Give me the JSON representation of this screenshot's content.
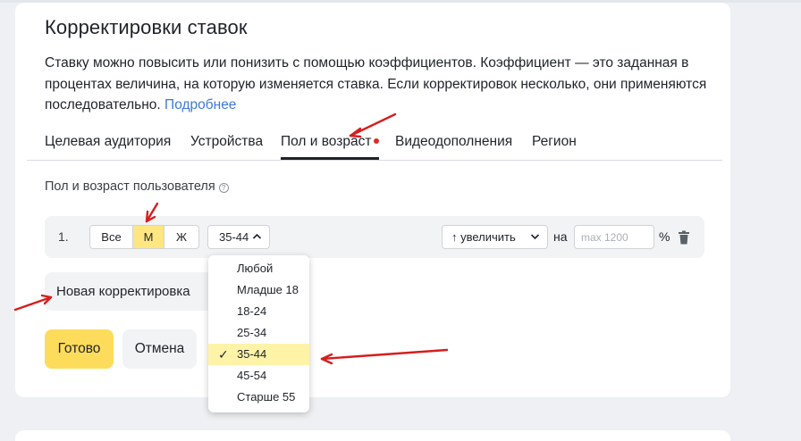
{
  "page": {
    "title": "Корректировки ставок",
    "description": "Ставку можно повысить или понизить с помощью коэффициентов. Коэффициент — это заданная в процентах величина, на которую изменяется ставка. Если корректировок несколько, они применяются последовательно.",
    "more_link": "Подробнее"
  },
  "tabs": [
    {
      "label": "Целевая аудитория",
      "active": false
    },
    {
      "label": "Устройства",
      "active": false
    },
    {
      "label": "Пол и возраст",
      "active": true
    },
    {
      "label": "Видеодополнения",
      "active": false
    },
    {
      "label": "Регион",
      "active": false
    }
  ],
  "section": {
    "label": "Пол и возраст пользователя",
    "help_icon": "question-circle-icon"
  },
  "row": {
    "number": "1.",
    "gender_options": [
      "Все",
      "М",
      "Ж"
    ],
    "gender_selected": "М",
    "age_value": "35-44",
    "direction_value": "↑ увеличить",
    "na_label": "на",
    "max_placeholder": "max 1200",
    "percent": "%",
    "delete_icon": "trash-icon"
  },
  "new_correction_label": "Новая корректировка",
  "buttons": {
    "done": "Готово",
    "cancel": "Отмена"
  },
  "age_dropdown": {
    "options": [
      "Любой",
      "Младше 18",
      "18-24",
      "25-34",
      "35-44",
      "45-54",
      "Старше 55"
    ],
    "selected": "35-44",
    "check_mark": "✓"
  },
  "colors": {
    "accent_yellow": "#fddc5c",
    "selected_segment": "#ffe680",
    "link": "#3f7ad6",
    "annotation_red": "#d61e1e"
  }
}
